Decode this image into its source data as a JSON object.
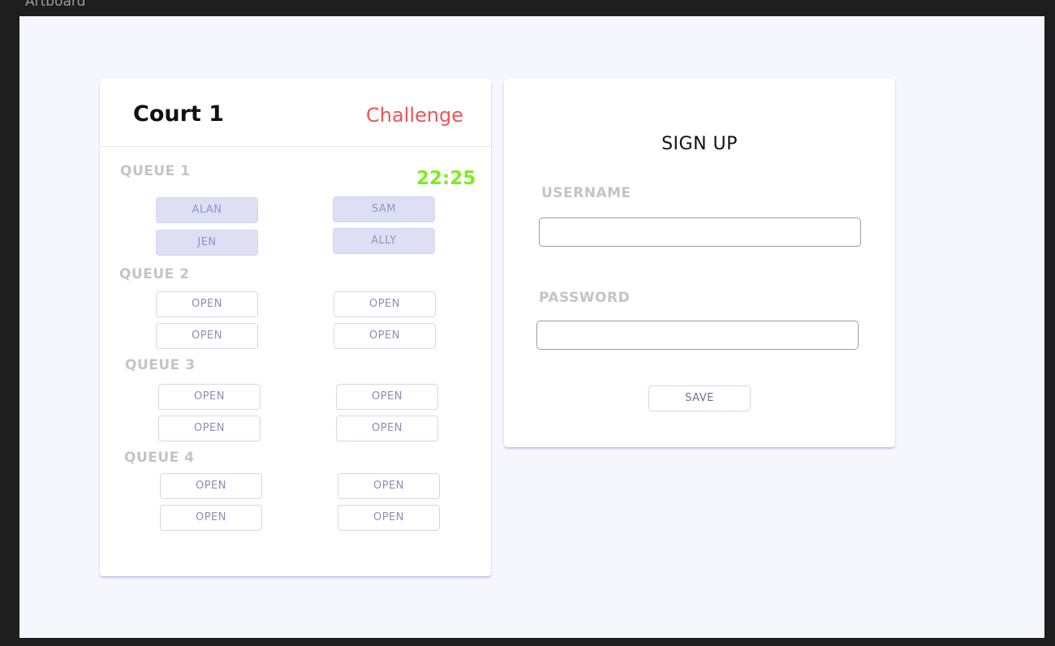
{
  "artboard": {
    "label": "Artboard"
  },
  "court": {
    "title": "Court 1",
    "challenge_label": "Challenge",
    "timer": "22:25",
    "queues": [
      {
        "label": "QUEUE 1",
        "slots": [
          "ALAN",
          "SAM",
          "JEN",
          "ALLY"
        ]
      },
      {
        "label": "QUEUE 2",
        "slots": [
          "OPEN",
          "OPEN",
          "OPEN",
          "OPEN"
        ]
      },
      {
        "label": "QUEUE 3",
        "slots": [
          "OPEN",
          "OPEN",
          "OPEN",
          "OPEN"
        ]
      },
      {
        "label": "QUEUE 4",
        "slots": [
          "OPEN",
          "OPEN",
          "OPEN",
          "OPEN"
        ]
      }
    ]
  },
  "signup": {
    "title": "SIGN UP",
    "username_label": "USERNAME",
    "username_value": "",
    "password_label": "PASSWORD",
    "password_value": "",
    "save_label": "SAVE"
  },
  "colors": {
    "challenge": "#f2545b",
    "timer": "#7ced1e",
    "filled_slot": "#dde0f5",
    "artboard_bg": "#f6f7fe"
  }
}
